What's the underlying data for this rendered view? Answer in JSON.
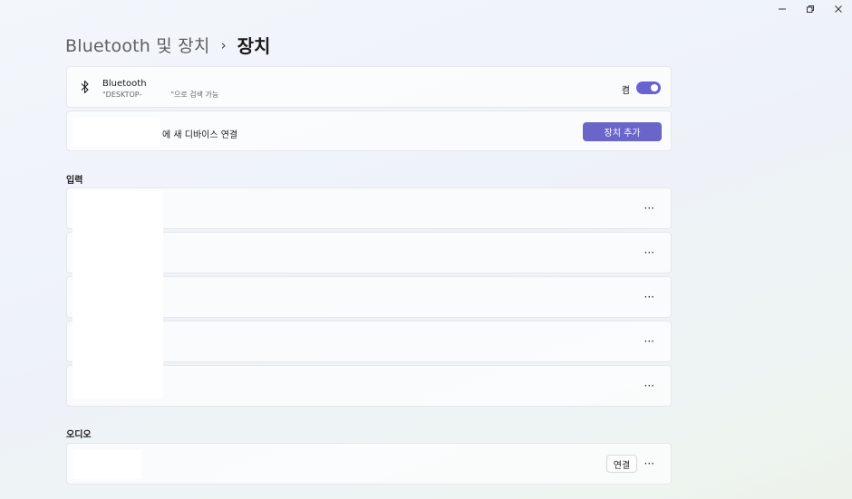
{
  "window": {
    "minimize_glyph": "—",
    "icons": [
      "minimize-icon",
      "restore-icon",
      "close-icon"
    ]
  },
  "breadcrumb": {
    "parent": "Bluetooth 및 장치",
    "separator": "›",
    "current": "장치"
  },
  "bluetooth": {
    "title": "Bluetooth",
    "subtitle_prefix": "\"DESKTOP-",
    "subtitle_suffix": "\"으로 검색 가능",
    "toggle_label": "켬",
    "toggle_on": true,
    "accent": "#6a62d3"
  },
  "add_device": {
    "text": "에 새 디바이스 연결",
    "button_label": "장치 추가"
  },
  "input_section": {
    "title": "입력",
    "rows": [
      {
        "more": "···"
      },
      {
        "more": "···"
      },
      {
        "more": "···"
      },
      {
        "more": "···"
      },
      {
        "more": "···"
      }
    ]
  },
  "audio_section": {
    "title": "오디오",
    "connect_label": "연결",
    "more": "···"
  }
}
